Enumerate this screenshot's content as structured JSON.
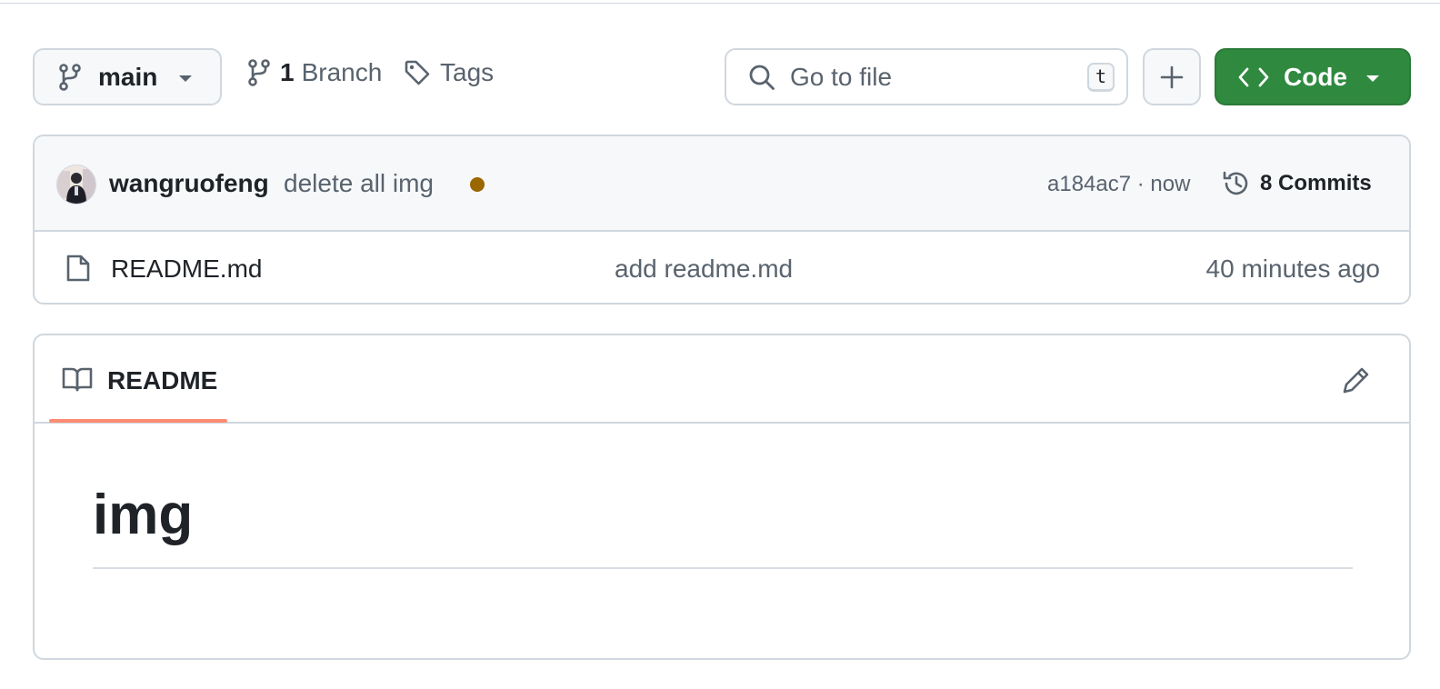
{
  "toolbar": {
    "branch_label": "main",
    "branch_count": "1",
    "branch_word": "Branch",
    "tags_label": "Tags",
    "search_placeholder": "Go to file",
    "search_shortcut": "t",
    "code_label": "Code"
  },
  "latest_commit": {
    "author": "wangruofeng",
    "message": "delete all img",
    "sha_time": "a184ac7 · now",
    "commits_label": "8 Commits"
  },
  "files": [
    {
      "name": "README.md",
      "message": "add readme.md",
      "time": "40 minutes ago"
    }
  ],
  "readme": {
    "tab_label": "README",
    "heading": "img"
  },
  "colors": {
    "code_button": "#2f8a3f",
    "status_dot": "#9a6700",
    "tab_underline": "#fd8c73"
  }
}
